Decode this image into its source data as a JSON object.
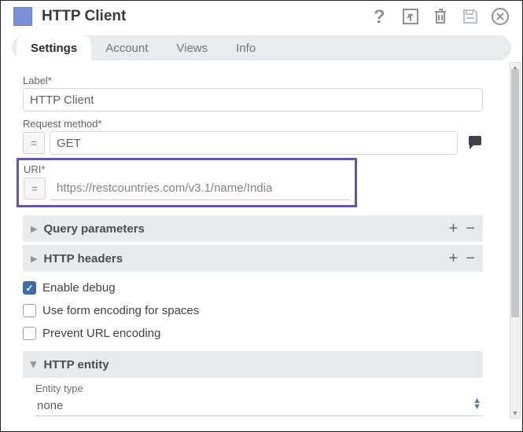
{
  "header": {
    "title": "HTTP Client"
  },
  "tabs": [
    {
      "label": "Settings",
      "active": true
    },
    {
      "label": "Account",
      "active": false
    },
    {
      "label": "Views",
      "active": false
    },
    {
      "label": "Info",
      "active": false
    }
  ],
  "fields": {
    "label": {
      "label": "Label*",
      "value": "HTTP Client"
    },
    "request_method": {
      "label": "Request method*",
      "value": "GET"
    },
    "uri": {
      "label": "URI*",
      "value": "https://restcountries.com/v3.1/name/India"
    }
  },
  "sections": {
    "query_params": {
      "title": "Query parameters"
    },
    "http_headers": {
      "title": "HTTP headers"
    },
    "http_entity": {
      "title": "HTTP entity"
    }
  },
  "checkboxes": {
    "enable_debug": {
      "label": "Enable debug",
      "checked": true
    },
    "form_encoding": {
      "label": "Use form encoding for spaces",
      "checked": false
    },
    "prevent_url": {
      "label": "Prevent URL encoding",
      "checked": false
    }
  },
  "entity": {
    "label": "Entity type",
    "value": "none"
  }
}
